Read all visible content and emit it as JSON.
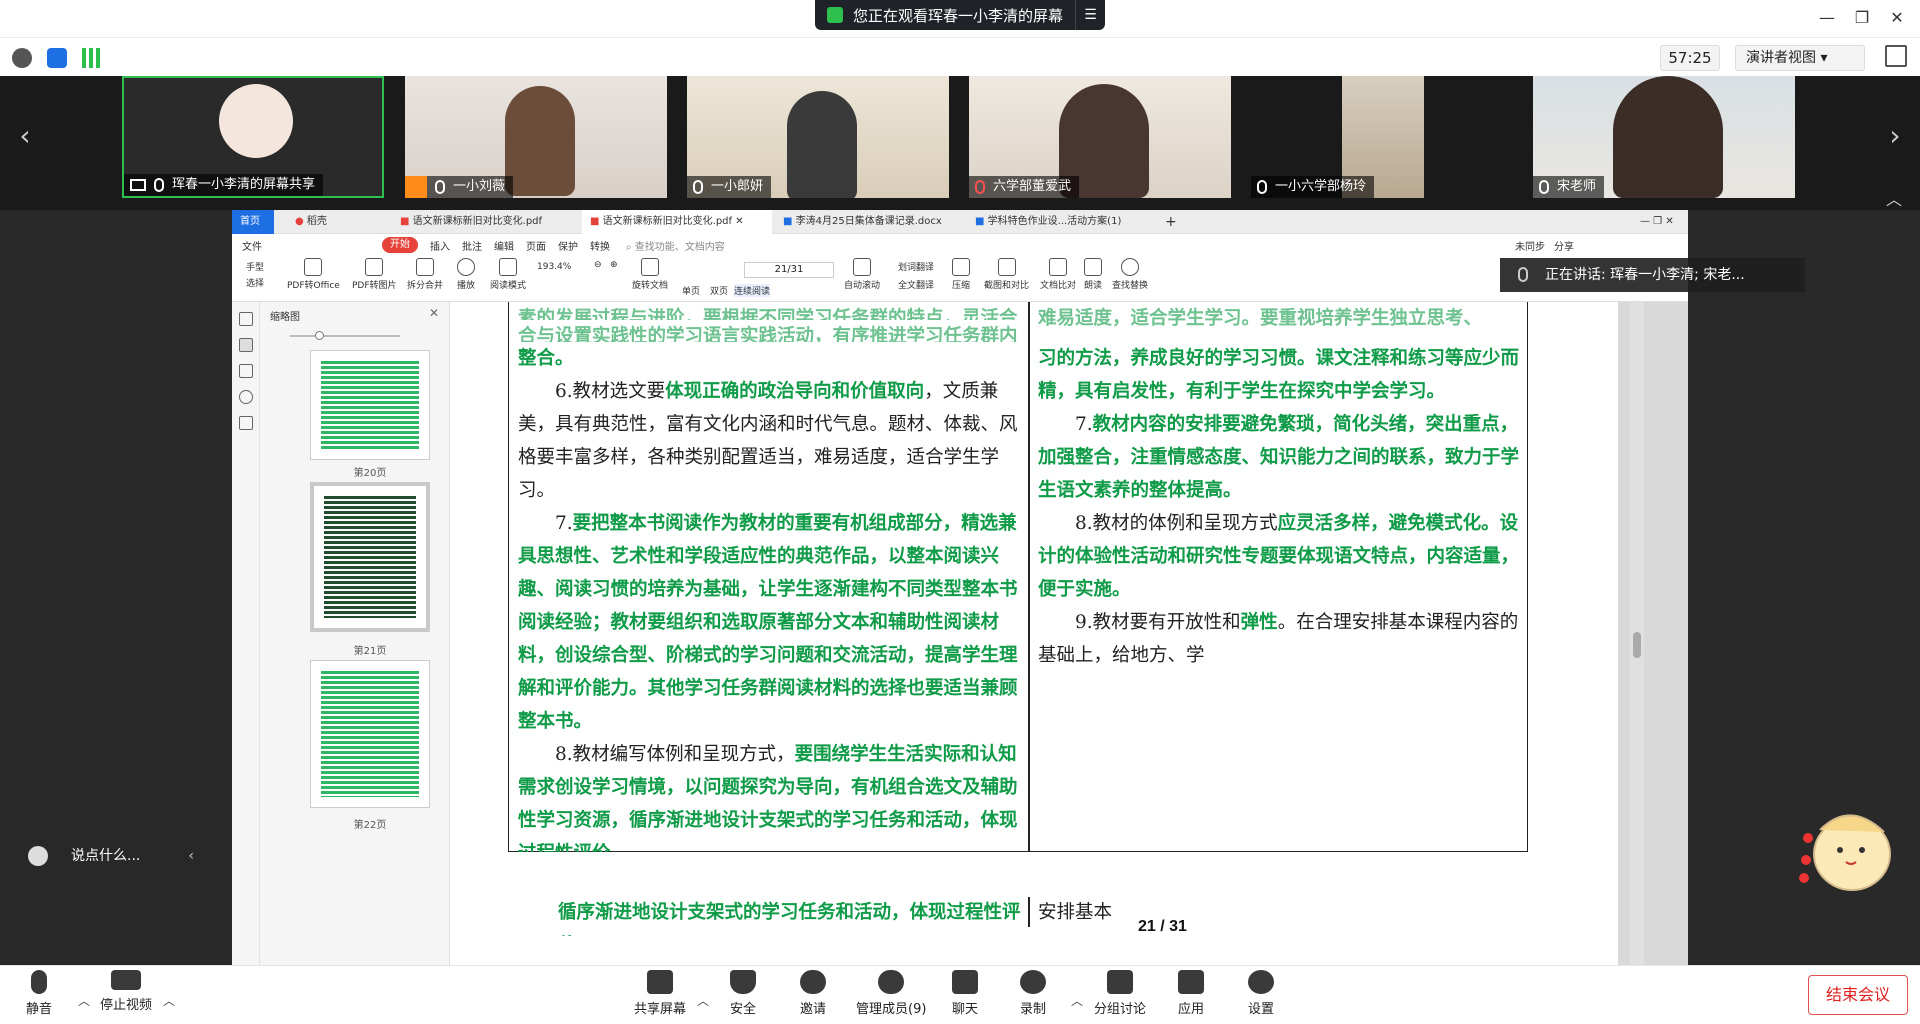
{
  "title_bar": {
    "share_banner": "您正在观看珲春一小李清的屏幕",
    "window_buttons": [
      "minimize-icon",
      "restore-icon",
      "close-icon"
    ]
  },
  "info_bar": {
    "timer": "57:25",
    "view_mode": "演讲者视图"
  },
  "participants": [
    {
      "name": "珲春一小李清的屏幕共享",
      "type": "screen-share"
    },
    {
      "name": "一小刘薇"
    },
    {
      "name": "一小郎妍"
    },
    {
      "name": "六学部董爱武",
      "muted": true
    },
    {
      "name": "一小六学部杨玲"
    },
    {
      "name": "宋老师"
    }
  ],
  "speaking_now": "正在讲话: 珲春一小李清; 宋老...",
  "app": {
    "tabs": [
      "首页",
      "稻壳",
      "语文新课标新旧对比变化.pdf",
      "语文新课标新旧对比变化.pdf",
      "李涛4月25日集体备课记录.docx",
      "学科特色作业设...活动方案(1)"
    ],
    "menu": [
      "文件",
      "开始",
      "插入",
      "批注",
      "编辑",
      "页面",
      "保护",
      "转换"
    ],
    "search_placeholder": "查找功能、文档内容",
    "menu_right": [
      "未同步",
      "分享"
    ],
    "ribbon": [
      "手型",
      "选择",
      "PDF转Office",
      "PDF转图片",
      "拆分合并",
      "播放",
      "阅读模式",
      "193.4%",
      "旋转文档",
      "单页",
      "双页",
      "连续阅读",
      "自动滚动",
      "划词翻译",
      "全文翻译",
      "压缩",
      "截图和对比",
      "文档比对",
      "朗读",
      "查找替换"
    ],
    "page_input": "21/31",
    "thumb_header": "缩略图",
    "thumb_labels": [
      "第20页",
      "第21页",
      "第22页"
    ]
  },
  "document": {
    "left_column": [
      {
        "seg": [
          {
            "t": "教材选文要",
            "c": "b"
          },
          {
            "t": "体现正确的政治导向和价值取向",
            "c": "g"
          },
          {
            "t": "，文质兼美，具有典范性，富有文化内涵和时代气息。题材、体裁、风格要丰富多样，各种类别配置适当，难易适度，适合学生学习。",
            "c": "b"
          }
        ],
        "num": "6."
      },
      {
        "seg": [
          {
            "t": "要把整本书阅读作为教材的重要有机组成部分，精选兼具思想性、艺术性和学段适应性的典范作品，以整本阅读兴趣、阅读习惯的培养为基础，让学生逐渐建构不同类型整本书阅读经验；教材要组织和选取原著部分文本和辅助性阅读材料，创设综合型、阶梯式的学习问题和交流活动，提高学生理解和评价能力。其他学习任务群阅读材料的选择也要适当兼顾整本书。",
            "c": "g"
          }
        ],
        "num": "7."
      },
      {
        "seg": [
          {
            "t": "教材编写体例和呈现方式，",
            "c": "b"
          },
          {
            "t": "要围绕学生生活实际和认知需求创设学习情境，以问题探究为导向，有机组合选文及辅助性学习资源，循序渐进地设计支架式的学习任务和活动，体现过程性评价，",
            "c": "g"
          }
        ],
        "num": "8."
      }
    ],
    "left_top_partial": "整合。",
    "right_column": [
      {
        "seg": [
          {
            "t": "习的方法，养成良好的学习习惯。课文注释和练习等应少而精，具有启发性，有利于学生在探究中学会学习。",
            "c": "g"
          }
        ],
        "num": ""
      },
      {
        "seg": [
          {
            "t": "教材内容的安排要避免繁琐，简化头绪，突出重点，加强整合，注重情感态度、知识能力之间的联系，致力于学生语文素养的整体提高。",
            "c": "g"
          }
        ],
        "num": "7."
      },
      {
        "seg": [
          {
            "t": "教材的体例和呈现方式",
            "c": "b"
          },
          {
            "t": "应灵活多样，避免模式化。设计的体验性活动和研究性专题要体现语文特点，内容适量，便于实施。",
            "c": "g"
          }
        ],
        "num": "8."
      },
      {
        "seg": [
          {
            "t": "教材要有开放性和",
            "c": "b"
          },
          {
            "t": "弹性",
            "c": "g"
          },
          {
            "t": "。在合理安排基本课程内容的基础上，给地方、学",
            "c": "b"
          }
        ],
        "num": "9."
      }
    ],
    "page_number": "21 / 31",
    "next_page_left": "循序渐进地设计支架式的学习任务和活动，体现过程性评价，",
    "next_page_right": "安排基本"
  },
  "chat_placeholder": "说点什么...",
  "bottom_bar": {
    "buttons": [
      "静音",
      "停止视频",
      "共享屏幕",
      "安全",
      "邀请",
      "管理成员(9)",
      "聊天",
      "录制",
      "分组讨论",
      "应用",
      "设置"
    ],
    "end": "结束会议"
  },
  "colors": {
    "accent_green": "#0f9b48",
    "wps_red": "#e6423a",
    "end_red": "#e02020"
  }
}
